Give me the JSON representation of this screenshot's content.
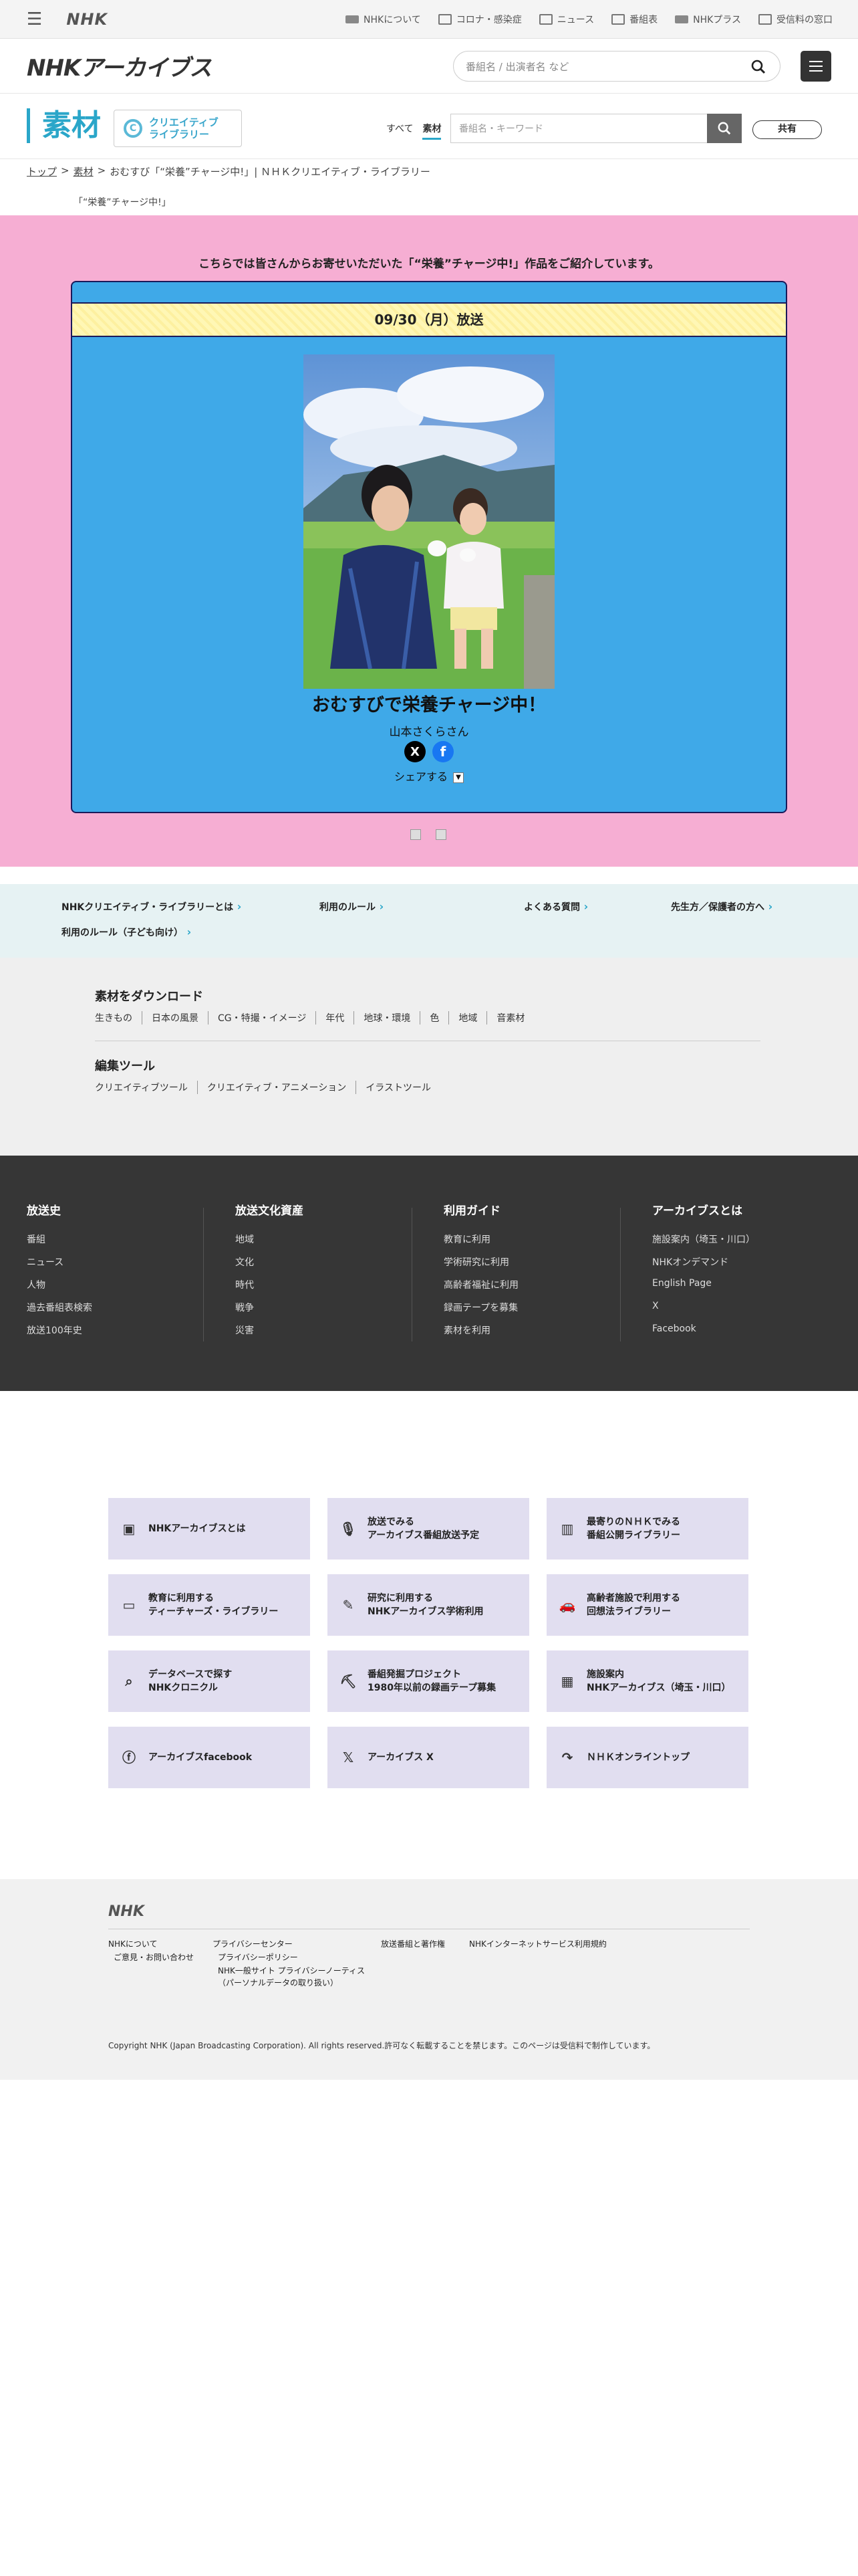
{
  "topbar": {
    "logo": "NHK",
    "links": [
      "NHKについて",
      "コロナ・感染症",
      "ニュース",
      "番組表",
      "NHKプラス",
      "受信料の窓口"
    ]
  },
  "header": {
    "logo": "NHKアーカイブス",
    "search_placeholder": "番組名 / 出演者名 など"
  },
  "section": {
    "title": "素材",
    "library_logo_line1": "クリエイティブ",
    "library_logo_line2": "ライブラリー",
    "tab_all": "すべて",
    "tab_material": "素材",
    "search_placeholder": "番組名・キーワード",
    "share_button": "共有"
  },
  "breadcrumb": {
    "top": "トップ",
    "material": "素材",
    "current": "おむすび「“栄養”チャージ中!」| ＮＨＫクリエイティブ・ライブラリー",
    "sep": ">"
  },
  "page_subtitle": "「“栄養”チャージ中!」",
  "feature": {
    "intro": "こちらでは皆さんからお寄せいただいた「“栄養”チャージ中!」作品をご紹介しています。",
    "date": "09/30（月）放送",
    "work_title": "おむすびで栄養チャージ中！",
    "author": "山本さくらさん",
    "share_label": "シェアする",
    "x_label": "X",
    "facebook_label": "f"
  },
  "info_links": [
    "NHKクリエイティブ・ライブラリーとは",
    "利用のルール",
    "よくある質問",
    "先生方／保護者の方へ",
    "利用のルール（子ども向け）"
  ],
  "download": {
    "heading": "素材をダウンロード",
    "items": [
      "生きもの",
      "日本の風景",
      "CG・特撮・イメージ",
      "年代",
      "地球・環境",
      "色",
      "地域",
      "音素材"
    ]
  },
  "edit_tools": {
    "heading": "編集ツール",
    "items": [
      "クリエイティブツール",
      "クリエイティブ・アニメーション",
      "イラストツール"
    ]
  },
  "footer_nav": [
    {
      "title": "放送史",
      "items": [
        "番組",
        "ニュース",
        "人物",
        "過去番組表検索",
        "放送100年史"
      ]
    },
    {
      "title": "放送文化資産",
      "items": [
        "地域",
        "文化",
        "時代",
        "戦争",
        "災害"
      ]
    },
    {
      "title": "利用ガイド",
      "items": [
        "教育に利用",
        "学術研究に利用",
        "高齢者福祉に利用",
        "録画テープを募集",
        "素材を利用"
      ]
    },
    {
      "title": "アーカイブスとは",
      "items": [
        "施設案内（埼玉・川口）",
        "NHKオンデマンド",
        "English Page",
        "X",
        "Facebook"
      ]
    }
  ],
  "tiles": [
    {
      "icon": "film-icon",
      "line1": "NHKアーカイブスとは",
      "line2": ""
    },
    {
      "icon": "microphone-icon",
      "line1": "放送でみる",
      "line2": "アーカイブス番組放送予定"
    },
    {
      "icon": "building-icon",
      "line1": "最寄りのＮＨＫでみる",
      "line2": "番組公開ライブラリー"
    },
    {
      "icon": "tv-icon",
      "line1": "教育に利用する",
      "line2": "ティーチャーズ・ライブラリー"
    },
    {
      "icon": "pen-icon",
      "line1": "研究に利用する",
      "line2": "NHKアーカイブス学術利用"
    },
    {
      "icon": "car-icon",
      "line1": "高齢者施設で利用する",
      "line2": "回想法ライブラリー"
    },
    {
      "icon": "search-database-icon",
      "line1": "データベースで探す",
      "line2": "NHKクロニクル"
    },
    {
      "icon": "dig-icon",
      "line1": "番組発掘プロジェクト",
      "line2": "1980年以前の録画テープ募集"
    },
    {
      "icon": "facility-icon",
      "line1": "施設案内",
      "line2": "NHKアーカイブス（埼玉・川口）"
    },
    {
      "icon": "facebook-icon",
      "line1": "アーカイブスfacebook",
      "line2": ""
    },
    {
      "icon": "x-icon",
      "line1": "アーカイブス X",
      "line2": ""
    },
    {
      "icon": "return-icon",
      "line1": "ＮＨＫオンライントップ",
      "line2": ""
    }
  ],
  "footer": {
    "logo": "NHK",
    "links": [
      "NHKについて",
      "ご意見・お問い合わせ",
      "プライバシーセンター",
      "プライバシーポリシー",
      "NHK一般サイト プライバシーノーティス",
      "（パーソナルデータの取り扱い）",
      "放送番組と著作権",
      "NHKインターネットサービス利用規約"
    ],
    "copyright": "Copyright NHK (Japan Broadcasting Corporation). All rights reserved.許可なく転載することを禁じます。このページは受信料で制作しています。"
  },
  "colors": {
    "pink": "#f6aed3",
    "blue": "#3fa9e8",
    "accent": "#2aa6c9",
    "dark": "#363636",
    "tile": "#e1def0"
  }
}
